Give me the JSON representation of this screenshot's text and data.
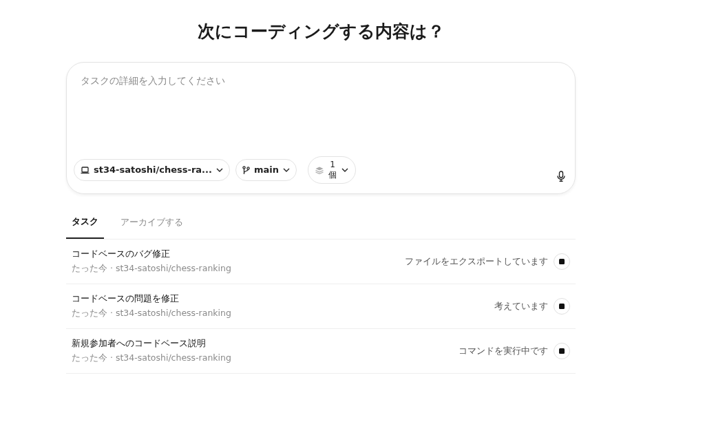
{
  "heading": "次にコーディングする内容は？",
  "composer": {
    "placeholder": "タスクの詳細を入力してください",
    "repo": "st34-satoshi/chess-ra...",
    "branch": "main",
    "versions": "1 個"
  },
  "tabs": [
    {
      "label": "タスク",
      "selected": true
    },
    {
      "label": "アーカイブする",
      "selected": false
    }
  ],
  "tasks": [
    {
      "title": "コードベースのバグ修正",
      "meta": "たった今 · st34-satoshi/chess-ranking",
      "status": "ファイルをエクスポートしています"
    },
    {
      "title": "コードベースの問題を修正",
      "meta": "たった今 · st34-satoshi/chess-ranking",
      "status": "考えています"
    },
    {
      "title": "新規参加者へのコードベース説明",
      "meta": "たった今 · st34-satoshi/chess-ranking",
      "status": "コマンドを実行中です"
    }
  ]
}
